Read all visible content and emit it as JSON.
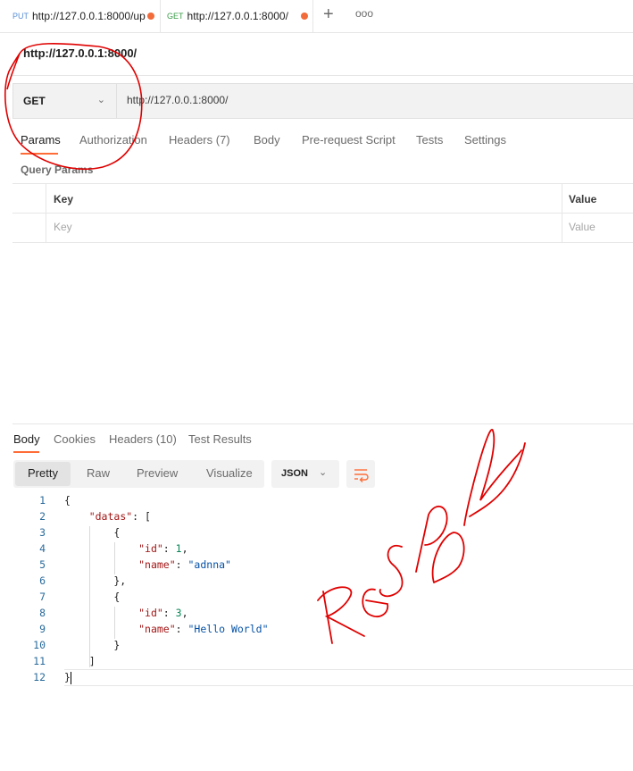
{
  "tabs": [
    {
      "method": "PUT",
      "url": "http://127.0.0.1:8000/up"
    },
    {
      "method": "GET",
      "url": "http://127.0.0.1:8000/"
    }
  ],
  "tab_actions": {
    "new_tab": "+",
    "more": "ooo"
  },
  "request": {
    "title": "http://127.0.0.1:8000/",
    "method": "GET",
    "url": "http://127.0.0.1:8000/"
  },
  "request_tabs": [
    "Params",
    "Authorization",
    "Headers (7)",
    "Body",
    "Pre-request Script",
    "Tests",
    "Settings"
  ],
  "query_params": {
    "title": "Query Params",
    "columns": [
      "Key",
      "Value"
    ],
    "placeholders": [
      "Key",
      "Value"
    ]
  },
  "response": {
    "tabs": [
      "Body",
      "Cookies",
      "Headers (10)",
      "Test Results"
    ],
    "view_modes": [
      "Pretty",
      "Raw",
      "Preview",
      "Visualize"
    ],
    "format": "JSON",
    "line_numbers": [
      "1",
      "2",
      "3",
      "4",
      "5",
      "6",
      "7",
      "8",
      "9",
      "10",
      "11",
      "12"
    ],
    "body": {
      "open": "{",
      "datas_key": "\"datas\"",
      "items": [
        {
          "id_key": "\"id\"",
          "id": "1",
          "name_key": "\"name\"",
          "name": "\"adnna\""
        },
        {
          "id_key": "\"id\"",
          "id": "3",
          "name_key": "\"name\"",
          "name": "\"Hello World\""
        }
      ],
      "close": "}"
    }
  },
  "annotation": {
    "text": "RESPoNSE",
    "color": "#e00000"
  }
}
